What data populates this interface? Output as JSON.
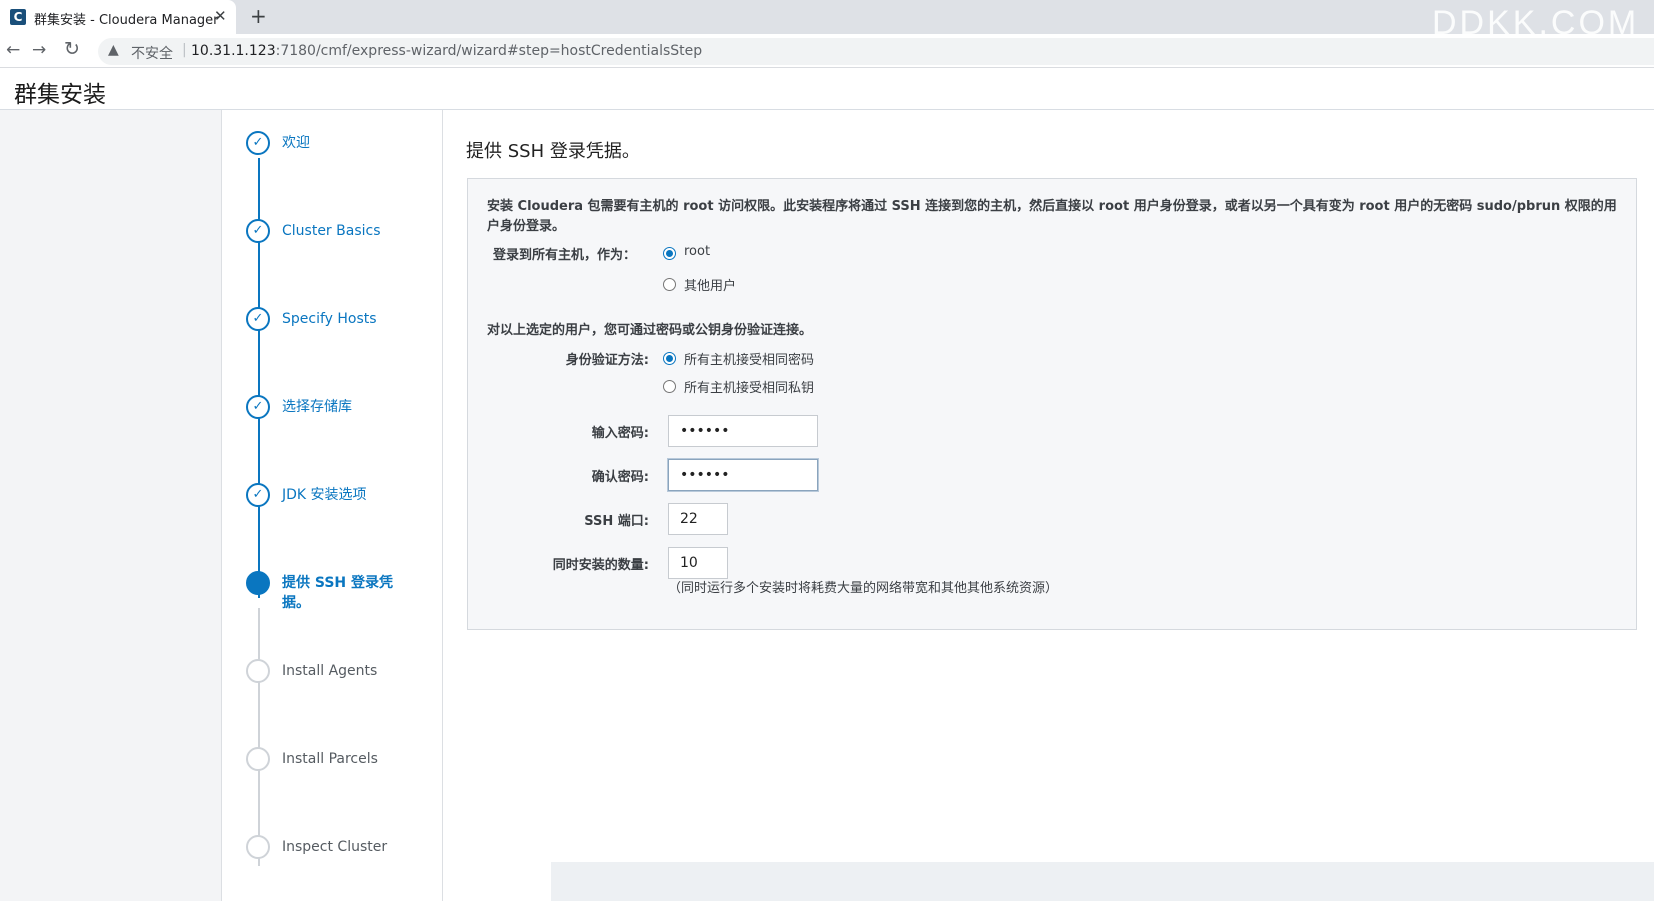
{
  "browser": {
    "tab_title": "群集安装 - Cloudera Manager",
    "tab_favicon": "C",
    "tab_close": "✕",
    "new_tab": "+",
    "back": "←",
    "forward": "→",
    "reload": "↻",
    "security_icon": "warning-triangle-icon",
    "security_text": "不安全",
    "url_host": "10.31.1.123",
    "url_rest": ":7180/cmf/express-wizard/wizard#step=hostCredentialsStep",
    "watermark": "DDKK.COM"
  },
  "header": {
    "title": "群集安装"
  },
  "steps": [
    {
      "label": "欢迎",
      "state": "done"
    },
    {
      "label": "Cluster Basics",
      "state": "done"
    },
    {
      "label": "Specify Hosts",
      "state": "done"
    },
    {
      "label": "选择存储库",
      "state": "done"
    },
    {
      "label": "JDK 安装选项",
      "state": "done"
    },
    {
      "label": "提供 SSH 登录凭据。",
      "state": "current"
    },
    {
      "label": "Install Agents",
      "state": "todo"
    },
    {
      "label": "Install Parcels",
      "state": "todo"
    },
    {
      "label": "Inspect Cluster",
      "state": "todo"
    }
  ],
  "main": {
    "title": "提供 SSH 登录凭据。",
    "intro": "安装 Cloudera 包需要有主机的 root 访问权限。此安装程序将通过 SSH 连接到您的主机，然后直接以 root 用户身份登录，或者以另一个具有变为 root 用户的无密码 sudo/pbrun 权限的用户身份登录。",
    "login_as_label": "登录到所有主机，作为：",
    "login_options": [
      "root",
      "其他用户"
    ],
    "login_selected": "root",
    "auth_section_text": "对以上选定的用户，您可通过密码或公钥身份验证连接。",
    "auth_method_label": "身份验证方法:",
    "auth_options": [
      "所有主机接受相同密码",
      "所有主机接受相同私钥"
    ],
    "auth_selected": "所有主机接受相同密码",
    "password_label": "输入密码:",
    "password_value": "••••••",
    "confirm_label": "确认密码:",
    "confirm_value": "••••••",
    "ssh_port_label": "SSH 端口:",
    "ssh_port_value": "22",
    "concurrent_label": "同时安装的数量:",
    "concurrent_value": "10",
    "concurrent_hint": "（同时运行多个安装时将耗费大量的网络带宽和其他其他系统资源）"
  }
}
